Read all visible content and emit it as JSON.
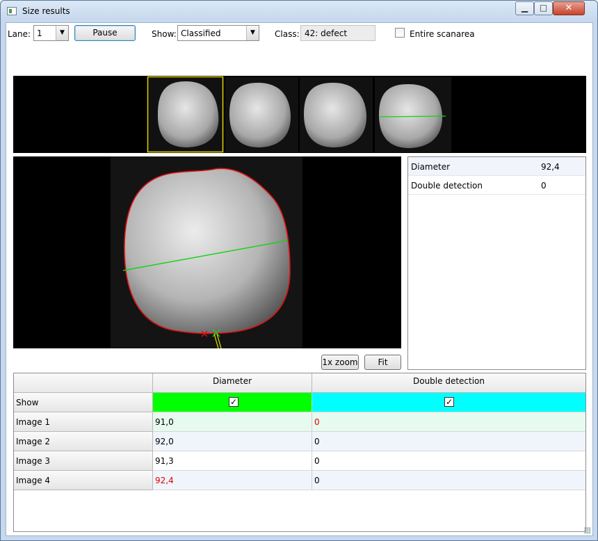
{
  "window": {
    "title": "Size results"
  },
  "toolbar": {
    "lane_label": "Lane:",
    "lane_value": "1",
    "pause_label": "Pause",
    "show_label": "Show:",
    "show_value": "Classified",
    "class_label": "Class:",
    "class_value": "42: defect",
    "entire_label": "Entire scanarea",
    "entire_checked": false
  },
  "filmstrip": {
    "count": 4,
    "selected_index": 0
  },
  "info": {
    "rows": [
      {
        "key": "Diameter",
        "value": "92,4"
      },
      {
        "key": "Double detection",
        "value": "0"
      }
    ]
  },
  "view_buttons": {
    "zoom": "1x zoom",
    "fit": "Fit"
  },
  "grid": {
    "columns": [
      "Diameter",
      "Double detection"
    ],
    "column_colors": [
      "#00ff00",
      "#00ffff"
    ],
    "show_row": {
      "label": "Show",
      "checked": [
        true,
        true
      ]
    },
    "rows": [
      {
        "label": "Image 1",
        "values": [
          "91,0",
          "0"
        ],
        "red": [
          false,
          true
        ]
      },
      {
        "label": "Image 2",
        "values": [
          "92,0",
          "0"
        ],
        "red": [
          false,
          false
        ]
      },
      {
        "label": "Image 3",
        "values": [
          "91,3",
          "0"
        ],
        "red": [
          false,
          false
        ]
      },
      {
        "label": "Image 4",
        "values": [
          "92,4",
          "0"
        ],
        "red": [
          true,
          false
        ]
      }
    ]
  }
}
